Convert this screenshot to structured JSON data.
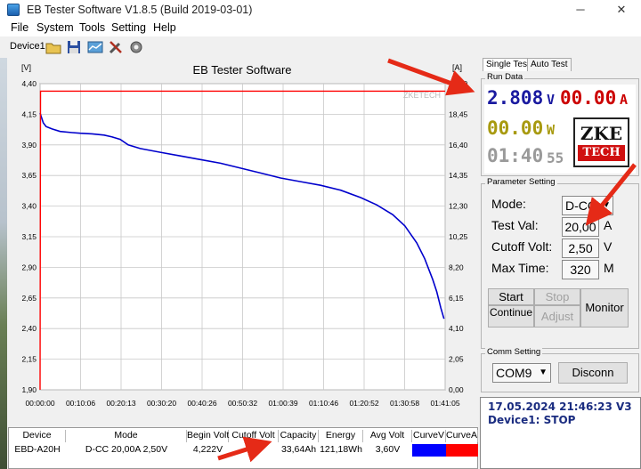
{
  "window": {
    "title": "EB Tester Software V1.8.5 (Build 2019-03-01)",
    "controls": {
      "minimize": "─",
      "maximize": "☐",
      "close": "✕"
    }
  },
  "menu": [
    "File",
    "System",
    "Tools",
    "Setting",
    "Help"
  ],
  "toolbar": {
    "device_label": "Device1",
    "icons": [
      "open-folder-icon",
      "save-icon",
      "chart-icon",
      "tools-icon",
      "gear-icon"
    ]
  },
  "chart": {
    "title": "EB Tester Software",
    "left_unit": "[V]",
    "right_unit": "[A]",
    "watermark": "ZKETECH"
  },
  "chart_data": {
    "type": "line",
    "title": "EB Tester Software",
    "ylabel": "[V]",
    "y2label": "[A]",
    "ylim": [
      1.9,
      4.4
    ],
    "y2lim": [
      0.0,
      20.5
    ],
    "yticks": [
      "4,40",
      "4,15",
      "3,90",
      "3,65",
      "3,40",
      "3,15",
      "2,90",
      "2,65",
      "2,40",
      "2,15",
      "1,90"
    ],
    "y2ticks": [
      "20,50",
      "18,45",
      "16,40",
      "14,35",
      "12,30",
      "10,25",
      "8,20",
      "6,15",
      "4,10",
      "2,05",
      "0,00"
    ],
    "xticks": [
      "00:00:00",
      "00:10:06",
      "00:20:13",
      "00:30:20",
      "00:40:26",
      "00:50:32",
      "01:00:39",
      "01:10:46",
      "01:20:52",
      "01:30:58",
      "01:41:05"
    ],
    "xlim_minutes": [
      0,
      101.08
    ],
    "grid": true,
    "series": [
      {
        "color": "#0000cc",
        "axis": "left",
        "x_minutes": [
          0,
          0.3,
          0.8,
          1.5,
          3,
          5,
          8,
          10,
          13,
          16,
          18,
          20,
          22,
          25,
          30,
          35,
          40,
          45,
          50,
          55,
          60,
          65,
          70,
          75,
          80,
          84,
          88,
          91,
          94,
          96,
          98,
          99,
          100,
          100.8
        ],
        "values": [
          4.16,
          4.13,
          4.08,
          4.05,
          4.03,
          4.01,
          4.0,
          3.995,
          3.99,
          3.98,
          3.965,
          3.945,
          3.9,
          3.87,
          3.84,
          3.81,
          3.78,
          3.75,
          3.71,
          3.67,
          3.63,
          3.6,
          3.57,
          3.53,
          3.47,
          3.41,
          3.33,
          3.24,
          3.1,
          2.97,
          2.8,
          2.7,
          2.57,
          2.48
        ]
      },
      {
        "color": "#ff0000",
        "axis": "right",
        "x_minutes": [
          0,
          0.1,
          0.2,
          101.08
        ],
        "values": [
          0.0,
          20.0,
          20.0,
          20.0
        ]
      }
    ]
  },
  "tabs": [
    "Single Test",
    "Auto Test"
  ],
  "run_data": {
    "title": "Run Data",
    "voltage": "2.808",
    "voltage_unit": "V",
    "current": "00.00",
    "current_unit": "A",
    "power": "00.00",
    "power_unit": "W",
    "time": "01:40",
    "time_seconds": "55",
    "logo_line1": "ZKE",
    "logo_line2": "TECH"
  },
  "parameter_setting": {
    "title": "Parameter Setting",
    "mode_label": "Mode:",
    "mode_value": "D-CC",
    "test_val_label": "Test Val:",
    "test_val": "20,00",
    "test_val_unit": "A",
    "cutoff_label": "Cutoff Volt:",
    "cutoff_value": "2,50",
    "cutoff_unit": "V",
    "max_time_label": "Max Time:",
    "max_time_value": "320",
    "max_time_unit": "M"
  },
  "buttons": {
    "start": "Start",
    "stop": "Stop",
    "continue": "Continue",
    "adjust": "Adjust",
    "monitor": "Monitor"
  },
  "comm_setting": {
    "title": "Comm Setting",
    "port": "COM9",
    "disconnect": "Disconn"
  },
  "status": {
    "line1": "17.05.2024 21:46:23  V3",
    "line2": "Device1:  STOP"
  },
  "table": {
    "headers": [
      "Device",
      "Mode",
      "Begin Volt",
      "Cutoff Volt",
      "Capacity",
      "Energy",
      "Avg Volt",
      "CurveV",
      "CurveA"
    ],
    "row": [
      "EBD-A20H",
      "D-CC  20,00A  2,50V",
      "4,222V",
      "2,5",
      "33,64Ah",
      "121,18Wh",
      "3,60V",
      "",
      ""
    ],
    "curveV_color": "#0000ff",
    "curveA_color": "#ff0000"
  }
}
